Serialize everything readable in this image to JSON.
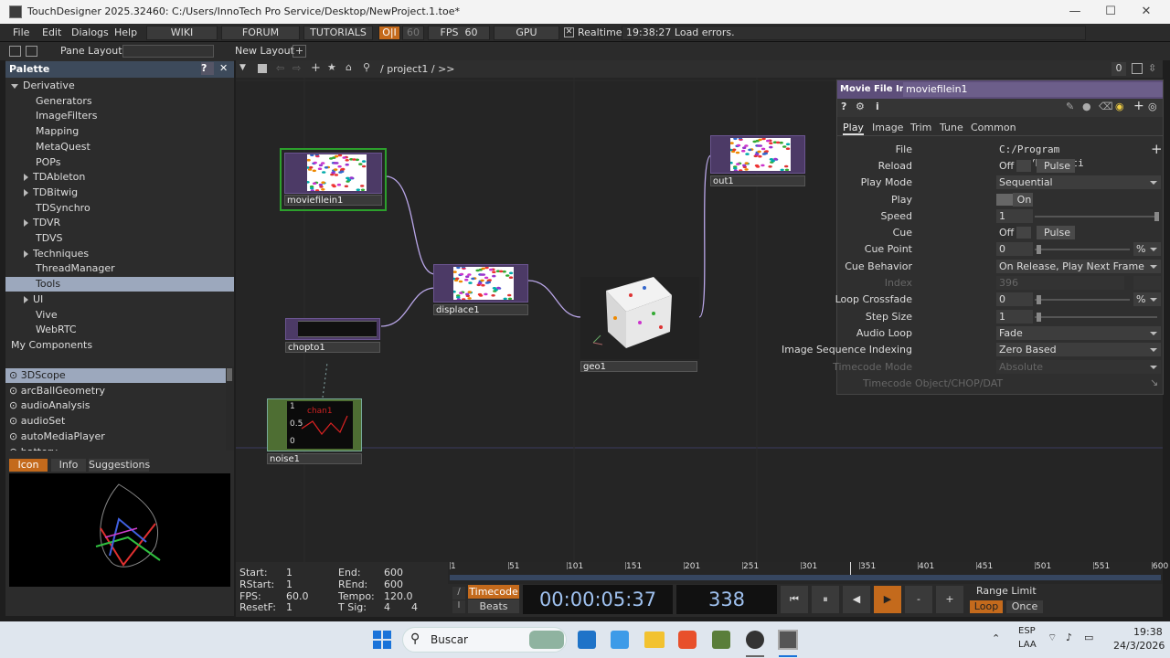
{
  "window": {
    "title": "TouchDesigner 2025.32460: C:/Users/InnoTech Pro Service/Desktop/NewProject.1.toe*"
  },
  "menubar": {
    "items": [
      "File",
      "Edit",
      "Dialogs",
      "Help"
    ],
    "buttons": {
      "wiki": "WIKI",
      "forum": "FORUM",
      "tutorials": "TUTORIALS",
      "oi": "O|I",
      "sixty": "60",
      "fps_label": "FPS",
      "fps_value": "60",
      "gpu": "GPU",
      "realtime": "Realtime",
      "status": "19:38:27 Load errors."
    }
  },
  "bar2": {
    "pane_layout": "Pane Layout",
    "new_layout": "New Layout"
  },
  "palette": {
    "title": "Palette",
    "help": "?",
    "tree": [
      {
        "label": "Derivative",
        "indent": 0,
        "expand": "down"
      },
      {
        "label": "Generators",
        "indent": 2,
        "expand": "none"
      },
      {
        "label": "ImageFilters",
        "indent": 2,
        "expand": "none"
      },
      {
        "label": "Mapping",
        "indent": 2,
        "expand": "none"
      },
      {
        "label": "MetaQuest",
        "indent": 2,
        "expand": "none"
      },
      {
        "label": "POPs",
        "indent": 2,
        "expand": "none"
      },
      {
        "label": "TDAbleton",
        "indent": 1,
        "expand": "right"
      },
      {
        "label": "TDBitwig",
        "indent": 1,
        "expand": "right"
      },
      {
        "label": "TDSynchro",
        "indent": 2,
        "expand": "none"
      },
      {
        "label": "TDVR",
        "indent": 1,
        "expand": "right"
      },
      {
        "label": "TDVS",
        "indent": 2,
        "expand": "none"
      },
      {
        "label": "Techniques",
        "indent": 1,
        "expand": "right"
      },
      {
        "label": "ThreadManager",
        "indent": 2,
        "expand": "none"
      },
      {
        "label": "Tools",
        "indent": 2,
        "expand": "none",
        "selected": true
      },
      {
        "label": "UI",
        "indent": 1,
        "expand": "right"
      },
      {
        "label": "Vive",
        "indent": 2,
        "expand": "none"
      },
      {
        "label": "WebRTC",
        "indent": 2,
        "expand": "none"
      },
      {
        "label": "My Components",
        "indent": 0,
        "expand": "none"
      }
    ],
    "components": [
      "3DScope",
      "arcBallGeometry",
      "audioAnalysis",
      "audioSet",
      "autoMediaPlayer",
      "battery"
    ],
    "tabs": [
      "Icon",
      "Info",
      "Suggestions"
    ]
  },
  "network": {
    "path": "/ project1 / >>",
    "count": "0",
    "nodes": {
      "moviefilein1": "moviefilein1",
      "out1": "out1",
      "displace1": "displace1",
      "chopto1": "chopto1",
      "geo1": "geo1",
      "noise1": "noise1",
      "noise_ticks": [
        "1",
        "0.5",
        "0"
      ],
      "noise_title": "chan1"
    }
  },
  "params": {
    "op_type": "Movie File In",
    "op_name": "moviefilein1",
    "tabs": [
      "Play",
      "Image",
      "Trim",
      "Tune",
      "Common"
    ],
    "file": {
      "label": "File",
      "value": "C:/Program Files/Derivati"
    },
    "reload": {
      "label": "Reload",
      "value": "Off",
      "button": "Pulse"
    },
    "play_mode": {
      "label": "Play Mode",
      "value": "Sequential"
    },
    "play": {
      "label": "Play",
      "value": "On"
    },
    "speed": {
      "label": "Speed",
      "value": "1"
    },
    "cue": {
      "label": "Cue",
      "value": "Off",
      "button": "Pulse"
    },
    "cue_point": {
      "label": "Cue Point",
      "value": "0",
      "unit": "%"
    },
    "cue_behavior": {
      "label": "Cue Behavior",
      "value": "On Release, Play Next Frame"
    },
    "index": {
      "label": "Index",
      "value": "396"
    },
    "loop_crossfade": {
      "label": "Loop Crossfade",
      "value": "0",
      "unit": "%"
    },
    "step_size": {
      "label": "Step Size",
      "value": "1"
    },
    "audio_loop": {
      "label": "Audio Loop",
      "value": "Fade"
    },
    "image_seq": {
      "label": "Image Sequence Indexing",
      "value": "Zero Based"
    },
    "timecode_mode": {
      "label": "Timecode Mode",
      "value": "Absolute"
    },
    "timecode_obj": {
      "label": "Timecode Object/CHOP/DAT"
    }
  },
  "timeline": {
    "start": {
      "label": "Start:",
      "value": "1"
    },
    "rstart": {
      "label": "RStart:",
      "value": "1"
    },
    "fps": {
      "label": "FPS:",
      "value": "60.0"
    },
    "resetf": {
      "label": "ResetF:",
      "value": "1"
    },
    "end": {
      "label": "End:",
      "value": "600"
    },
    "rend": {
      "label": "REnd:",
      "value": "600"
    },
    "tempo": {
      "label": "Tempo:",
      "value": "120.0"
    },
    "tsig": {
      "label": "T Sig:",
      "value1": "4",
      "value2": "4"
    },
    "ruler": [
      "1",
      "51",
      "101",
      "151",
      "201",
      "251",
      "301",
      "351",
      "401",
      "451",
      "501",
      "551",
      "600"
    ],
    "timecode_btn": "Timecode",
    "beats_btn": "Beats",
    "timecode": "00:00:05:37",
    "frame": "338",
    "minus": "-",
    "plus": "+",
    "range_limit": "Range Limit",
    "loop": "Loop",
    "once": "Once"
  },
  "taskbar": {
    "search": "Buscar",
    "lang1": "ESP",
    "lang2": "LAA",
    "time": "19:38",
    "date": "24/3/2026"
  }
}
